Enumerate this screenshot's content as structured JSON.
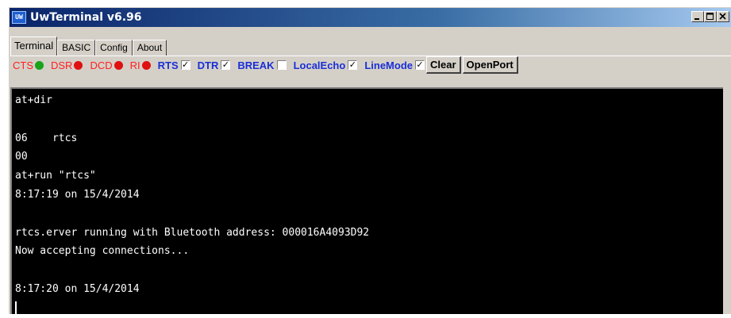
{
  "window": {
    "title": "UwTerminal v6.96",
    "icon": "uw-app-icon"
  },
  "window_buttons": [
    "minimize-icon",
    "maximize-icon",
    "close-icon"
  ],
  "tabs": [
    {
      "label": "Terminal",
      "active": true
    },
    {
      "label": "BASIC",
      "active": false
    },
    {
      "label": "Config",
      "active": false
    },
    {
      "label": "About",
      "active": false
    }
  ],
  "signals": [
    {
      "label": "CTS",
      "color": "#1aa31a"
    },
    {
      "label": "DSR",
      "color": "#e01010"
    },
    {
      "label": "DCD",
      "color": "#e01010"
    },
    {
      "label": "RI",
      "color": "#e01010"
    }
  ],
  "controls": [
    {
      "label": "RTS",
      "checked": true
    },
    {
      "label": "DTR",
      "checked": true
    },
    {
      "label": "BREAK",
      "checked": false
    },
    {
      "label": "LocalEcho",
      "checked": true
    },
    {
      "label": "LineMode",
      "checked": true
    }
  ],
  "buttons": {
    "clear": "Clear",
    "open_port": "OpenPort"
  },
  "terminal": {
    "lines": [
      "at+dir",
      "",
      "06    rtcs",
      "00",
      "at+run \"rtcs\"",
      "8:17:19 on 15/4/2014",
      "",
      "rtcs.erver running with Bluetooth address: 000016A4093D92",
      "Now accepting connections...",
      "",
      "8:17:20 on 15/4/2014"
    ]
  },
  "colors": {
    "signal_label": "#ff2020",
    "control_label": "#1a2fd8",
    "terminal_bg": "#000000",
    "terminal_fg": "#ffffff",
    "window_bg": "#d4d0c8"
  }
}
